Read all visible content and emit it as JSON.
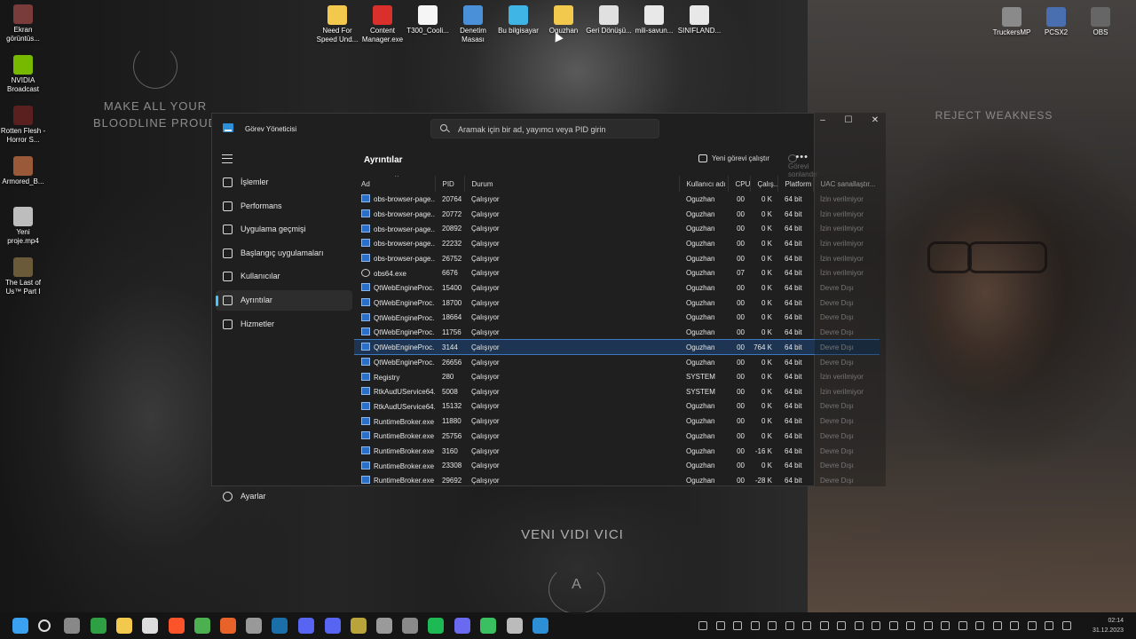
{
  "wallpaper": {
    "text_left": "MAKE ALL YOUR BLOODLINE PROUD",
    "text_right": "REJECT WEAKNESS",
    "text_center": "VENI VIDI VICI",
    "emblem_letter": "A"
  },
  "desktop_icons_left": [
    {
      "label": "Ekran görüntüs...",
      "icon": "screenshot-icon",
      "color": "#7a3b3b"
    },
    {
      "label": "NVIDIA Broadcast",
      "icon": "nvidia-icon",
      "color": "#76b900"
    },
    {
      "label": "Rotten Flesh - Horror S...",
      "icon": "game-icon",
      "color": "#5a2020"
    },
    {
      "label": "Armored_B...",
      "icon": "game-icon",
      "color": "#9a5a3a"
    },
    {
      "label": "Yeni proje.mp4",
      "icon": "video-icon",
      "color": "#bdbdbd"
    },
    {
      "label": "The Last of Us™ Part I",
      "icon": "game-icon",
      "color": "#6a5a3a"
    }
  ],
  "desktop_icons_top": [
    {
      "label": "Need For Speed Und...",
      "icon": "folder-icon",
      "color": "#f2c94c"
    },
    {
      "label": "Content Manager.exe",
      "icon": "app-icon",
      "color": "#d9302c"
    },
    {
      "label": "T300_Cooli...",
      "icon": "file-icon",
      "color": "#f5f5f5"
    },
    {
      "label": "Denetim Masası",
      "icon": "control-panel-icon",
      "color": "#4a90d9"
    },
    {
      "label": "Bu bilgisayar",
      "icon": "computer-icon",
      "color": "#3fb5e6"
    },
    {
      "label": "Oguzhan",
      "icon": "folder-icon",
      "color": "#f2c94c"
    },
    {
      "label": "Geri Dönüşü...",
      "icon": "recycle-bin-icon",
      "color": "#e0e0e0"
    },
    {
      "label": "mili-savun...",
      "icon": "chrome-icon",
      "color": "#e8e8e8"
    },
    {
      "label": "SINIFLAND...",
      "icon": "chrome-icon",
      "color": "#e8e8e8"
    }
  ],
  "desktop_icons_right": [
    {
      "label": "TruckersMP",
      "icon": "truck-icon",
      "color": "#8a8a8a"
    },
    {
      "label": "PCSX2",
      "icon": "pcsx2-icon",
      "color": "#4a6fb0"
    },
    {
      "label": "OBS",
      "icon": "obs-icon",
      "color": "#666666"
    }
  ],
  "window": {
    "title": "Görev Yöneticisi",
    "search_placeholder": "Aramak için bir ad, yayımcı veya PID girin",
    "minimize": "–",
    "maximize": "☐",
    "close": "✕"
  },
  "nav": {
    "items": [
      {
        "label": "İşlemler",
        "icon": "processes-icon"
      },
      {
        "label": "Performans",
        "icon": "performance-icon"
      },
      {
        "label": "Uygulama geçmişi",
        "icon": "history-icon"
      },
      {
        "label": "Başlangıç uygulamaları",
        "icon": "startup-icon"
      },
      {
        "label": "Kullanıcılar",
        "icon": "users-icon"
      },
      {
        "label": "Ayrıntılar",
        "icon": "details-icon",
        "active": true
      },
      {
        "label": "Hizmetler",
        "icon": "services-icon"
      }
    ],
    "settings_label": "Ayarlar"
  },
  "details": {
    "title": "Ayrıntılar",
    "run_new_task": "Yeni görevi çalıştır",
    "end_task": "Görevi sonlandır",
    "more": "•••",
    "columns": [
      "Ad",
      "PID",
      "Durum",
      "Kullanıcı adı",
      "CPU",
      "Çalış...",
      "Platform",
      "UAC sanallaştır..."
    ],
    "rows": [
      {
        "name": "obs-browser-page....",
        "pid": "20764",
        "status": "Çalışıyor",
        "user": "Oguzhan",
        "cpu": "00",
        "mem": "0 K",
        "platform": "64 bit",
        "uac": "İzin verilmiyor",
        "icon": "obs-browser"
      },
      {
        "name": "obs-browser-page....",
        "pid": "20772",
        "status": "Çalışıyor",
        "user": "Oguzhan",
        "cpu": "00",
        "mem": "0 K",
        "platform": "64 bit",
        "uac": "İzin verilmiyor",
        "icon": "obs-browser"
      },
      {
        "name": "obs-browser-page....",
        "pid": "20892",
        "status": "Çalışıyor",
        "user": "Oguzhan",
        "cpu": "00",
        "mem": "0 K",
        "platform": "64 bit",
        "uac": "İzin verilmiyor",
        "icon": "obs-browser"
      },
      {
        "name": "obs-browser-page....",
        "pid": "22232",
        "status": "Çalışıyor",
        "user": "Oguzhan",
        "cpu": "00",
        "mem": "0 K",
        "platform": "64 bit",
        "uac": "İzin verilmiyor",
        "icon": "obs-browser"
      },
      {
        "name": "obs-browser-page....",
        "pid": "26752",
        "status": "Çalışıyor",
        "user": "Oguzhan",
        "cpu": "00",
        "mem": "0 K",
        "platform": "64 bit",
        "uac": "İzin verilmiyor",
        "icon": "obs-browser"
      },
      {
        "name": "obs64.exe",
        "pid": "6676",
        "status": "Çalışıyor",
        "user": "Oguzhan",
        "cpu": "07",
        "mem": "0 K",
        "platform": "64 bit",
        "uac": "İzin verilmiyor",
        "icon": "obs"
      },
      {
        "name": "QtWebEngineProc...",
        "pid": "15400",
        "status": "Çalışıyor",
        "user": "Oguzhan",
        "cpu": "00",
        "mem": "0 K",
        "platform": "64 bit",
        "uac": "Devre Dışı",
        "icon": "app"
      },
      {
        "name": "QtWebEngineProc...",
        "pid": "18700",
        "status": "Çalışıyor",
        "user": "Oguzhan",
        "cpu": "00",
        "mem": "0 K",
        "platform": "64 bit",
        "uac": "Devre Dışı",
        "icon": "app"
      },
      {
        "name": "QtWebEngineProc...",
        "pid": "18664",
        "status": "Çalışıyor",
        "user": "Oguzhan",
        "cpu": "00",
        "mem": "0 K",
        "platform": "64 bit",
        "uac": "Devre Dışı",
        "icon": "app"
      },
      {
        "name": "QtWebEngineProc...",
        "pid": "11756",
        "status": "Çalışıyor",
        "user": "Oguzhan",
        "cpu": "00",
        "mem": "0 K",
        "platform": "64 bit",
        "uac": "Devre Dışı",
        "icon": "app"
      },
      {
        "name": "QtWebEngineProc...",
        "pid": "3144",
        "status": "Çalışıyor",
        "user": "Oguzhan",
        "cpu": "00",
        "mem": "764 K",
        "platform": "64 bit",
        "uac": "Devre Dışı",
        "icon": "app",
        "selected": true
      },
      {
        "name": "QtWebEngineProc...",
        "pid": "26656",
        "status": "Çalışıyor",
        "user": "Oguzhan",
        "cpu": "00",
        "mem": "0 K",
        "platform": "64 bit",
        "uac": "Devre Dışı",
        "icon": "app"
      },
      {
        "name": "Registry",
        "pid": "280",
        "status": "Çalışıyor",
        "user": "SYSTEM",
        "cpu": "00",
        "mem": "0 K",
        "platform": "64 bit",
        "uac": "İzin verilmiyor",
        "icon": "app"
      },
      {
        "name": "RtkAudUService64....",
        "pid": "5008",
        "status": "Çalışıyor",
        "user": "SYSTEM",
        "cpu": "00",
        "mem": "0 K",
        "platform": "64 bit",
        "uac": "İzin verilmiyor",
        "icon": "app"
      },
      {
        "name": "RtkAudUService64....",
        "pid": "15132",
        "status": "Çalışıyor",
        "user": "Oguzhan",
        "cpu": "00",
        "mem": "0 K",
        "platform": "64 bit",
        "uac": "Devre Dışı",
        "icon": "app"
      },
      {
        "name": "RuntimeBroker.exe",
        "pid": "11880",
        "status": "Çalışıyor",
        "user": "Oguzhan",
        "cpu": "00",
        "mem": "0 K",
        "platform": "64 bit",
        "uac": "Devre Dışı",
        "icon": "app"
      },
      {
        "name": "RuntimeBroker.exe",
        "pid": "25756",
        "status": "Çalışıyor",
        "user": "Oguzhan",
        "cpu": "00",
        "mem": "0 K",
        "platform": "64 bit",
        "uac": "Devre Dışı",
        "icon": "app"
      },
      {
        "name": "RuntimeBroker.exe",
        "pid": "3160",
        "status": "Çalışıyor",
        "user": "Oguzhan",
        "cpu": "00",
        "mem": "-16 K",
        "platform": "64 bit",
        "uac": "Devre Dışı",
        "icon": "app"
      },
      {
        "name": "RuntimeBroker.exe",
        "pid": "23308",
        "status": "Çalışıyor",
        "user": "Oguzhan",
        "cpu": "00",
        "mem": "0 K",
        "platform": "64 bit",
        "uac": "Devre Dışı",
        "icon": "app"
      },
      {
        "name": "RuntimeBroker.exe",
        "pid": "29692",
        "status": "Çalışıyor",
        "user": "Oguzhan",
        "cpu": "00",
        "mem": "-28 K",
        "platform": "64 bit",
        "uac": "Devre Dışı",
        "icon": "app"
      }
    ]
  },
  "taskbar": {
    "apps": [
      {
        "name": "start-button",
        "color": "#3aa0f0"
      },
      {
        "name": "search-icon",
        "color": "#dddddd"
      },
      {
        "name": "app-icon",
        "color": "#888888"
      },
      {
        "name": "xbox-icon",
        "color": "#2ea043"
      },
      {
        "name": "file-explorer-icon",
        "color": "#f2c94c"
      },
      {
        "name": "store-icon",
        "color": "#dddddd"
      },
      {
        "name": "brave-icon",
        "color": "#fb542b"
      },
      {
        "name": "chrome-icon",
        "color": "#4caf50"
      },
      {
        "name": "app-icon",
        "color": "#e8632a"
      },
      {
        "name": "app-icon",
        "color": "#999999"
      },
      {
        "name": "steam-icon",
        "color": "#1b6fa8"
      },
      {
        "name": "app-icon",
        "color": "#5865f2"
      },
      {
        "name": "discord-icon",
        "color": "#5865f2"
      },
      {
        "name": "app-icon",
        "color": "#b8a43a"
      },
      {
        "name": "app-icon",
        "color": "#9a9a9a"
      },
      {
        "name": "app-icon",
        "color": "#8a8a8a"
      },
      {
        "name": "spotify-icon",
        "color": "#1db954"
      },
      {
        "name": "app-icon",
        "color": "#6a6af0"
      },
      {
        "name": "app-icon",
        "color": "#3ac060"
      },
      {
        "name": "app-icon",
        "color": "#bbbbbb"
      },
      {
        "name": "task-manager-icon",
        "color": "#2d8fd5"
      }
    ],
    "clock_time": "02:14",
    "clock_date": "31.12.2023"
  }
}
